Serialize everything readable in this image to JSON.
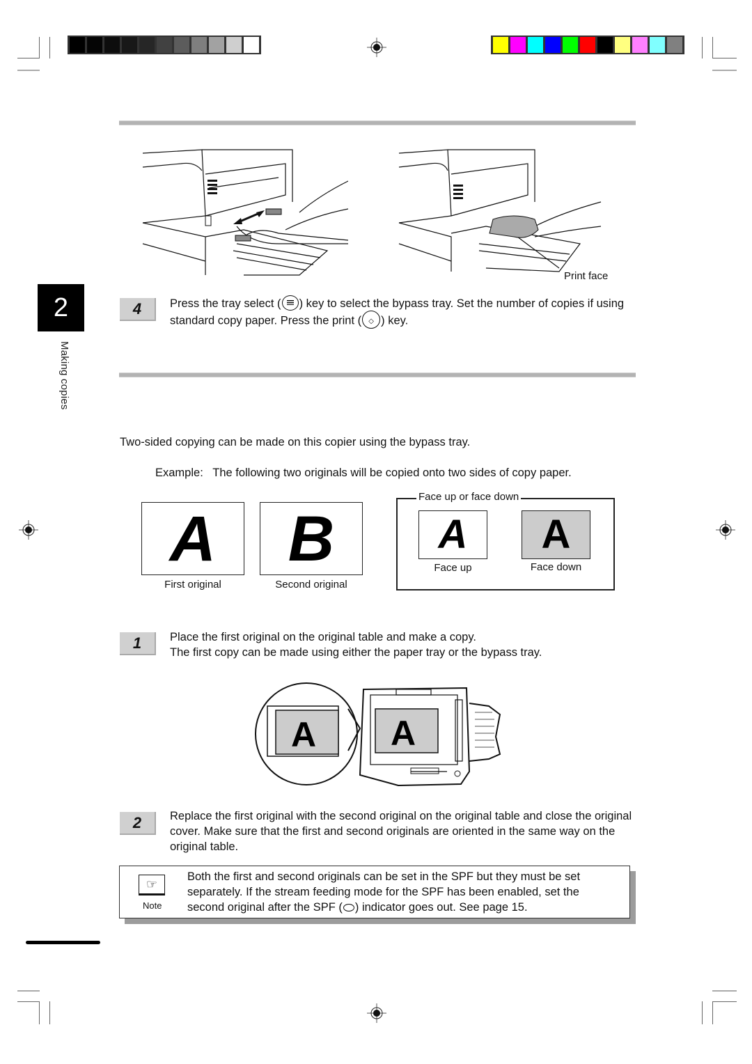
{
  "print_marks": {
    "grayscale_swatches": [
      "#000000",
      "#050505",
      "#0d0d0d",
      "#181818",
      "#262626",
      "#414141",
      "#5c5c5c",
      "#7f7f7f",
      "#a2a2a2",
      "#cfcfcf",
      "#ffffff"
    ],
    "color_swatches": [
      "#ffff00",
      "#ff00ff",
      "#00ffff",
      "#0000ff",
      "#00ff00",
      "#ff0000",
      "#000000",
      "#ffff80",
      "#ff80ff",
      "#80ffff",
      "#808080"
    ]
  },
  "chapter": {
    "number": "2",
    "title": "Making copies"
  },
  "section_bypass": {
    "illustration_left": "hands-adjusting-bypass-guides",
    "illustration_right": "paper-loaded-in-bypass-tray",
    "print_face_label": "Print face",
    "step4": {
      "number": "4",
      "text_before_tray": "Press the tray select (",
      "text_after_tray": ") key to select the bypass tray. Set the number of copies if using standard copy paper. Press the print (",
      "text_after_print": ") key.",
      "tray_key_icon": "tray-select-key-icon",
      "print_key_icon": "print-key-icon",
      "print_key_glyph": "◇"
    }
  },
  "section_two_sided": {
    "intro": "Two-sided copying can be made on this copier using the bypass tray.",
    "example": "Example:   The following two originals will be copied onto two sides of copy paper.",
    "originals": [
      {
        "letter": "A",
        "caption": "First original"
      },
      {
        "letter": "B",
        "caption": "Second original"
      }
    ],
    "face_frame": {
      "title": "Face up or face down",
      "items": [
        {
          "letter": "A",
          "caption": "Face up",
          "fill": "#ffffff"
        },
        {
          "letter": "A",
          "caption": "Face down",
          "fill": "#cccccc"
        }
      ]
    },
    "step1": {
      "number": "1",
      "line1": "Place the first original on the original table and make a copy.",
      "line2": "The first copy can be made using either the paper tray or the bypass tray."
    },
    "scanner_letter": "A",
    "step2": {
      "number": "2",
      "text": "Replace the first original with the second original on the original table and close the original cover. Make sure that the first and second originals are oriented in the same way on the original table."
    },
    "note": {
      "label": "Note",
      "icon_glyph": "☞",
      "text_before": "Both the first and second originals can be set in the SPF but they must be set separately. If the stream feeding mode for the SPF has been enabled, set the second original after the SPF (",
      "text_after": ") indicator goes out. See page 15."
    }
  }
}
